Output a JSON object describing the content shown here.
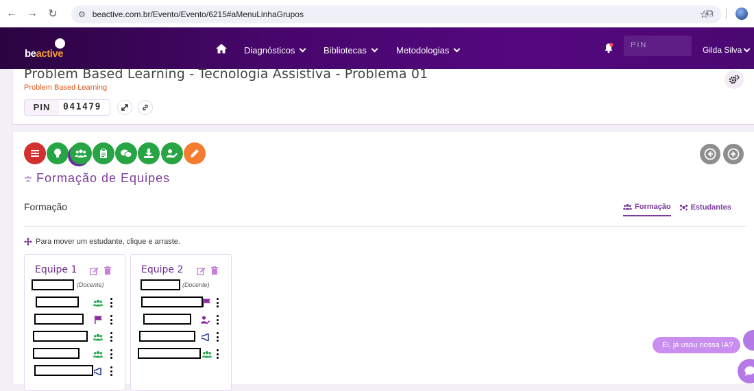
{
  "browser": {
    "url": "beactive.com.br/Evento/Evento/6215#aMenuLinhaGrupos"
  },
  "header": {
    "logo_be": "be",
    "logo_active": "active",
    "nav": [
      {
        "label": "Diagnósticos"
      },
      {
        "label": "Bibliotecas"
      },
      {
        "label": "Metodologias"
      }
    ],
    "pin_placeholder": "PIN",
    "user_name": "Gilda Silva",
    "colors": {
      "header_bg": "#46066a",
      "accent": "#f29a2e"
    }
  },
  "event": {
    "title": "Problem Based Learning - Tecnologia Assistiva - Problema 01",
    "methodology": "Problem Based Learning",
    "pin_label": "PIN",
    "pin_value": "041479"
  },
  "toolbar": {
    "buttons": [
      {
        "icon": "menu-icon",
        "color": "#d32f2f"
      },
      {
        "icon": "lightbulb-icon",
        "color": "#27a444"
      },
      {
        "icon": "users-icon",
        "color": "#27a444"
      },
      {
        "icon": "clipboard-icon",
        "color": "#27a444"
      },
      {
        "icon": "comments-icon",
        "color": "#27a444"
      },
      {
        "icon": "download-icon",
        "color": "#27a444"
      },
      {
        "icon": "user-edit-icon",
        "color": "#27a444"
      },
      {
        "icon": "pencil-icon",
        "color": "#f47c30"
      }
    ]
  },
  "section": {
    "title": "Formação de Equipes",
    "label": "Formação",
    "tabs": [
      {
        "label": "Formação",
        "active": true
      },
      {
        "label": "Estudantes",
        "active": false
      }
    ],
    "hint": "Para mover um estudante, clique e arraste."
  },
  "teams": [
    {
      "name": "Equipe 1",
      "docente": "(Docente)",
      "members": [
        {
          "role_icon": "users-icon"
        },
        {
          "role_icon": "flag-icon"
        },
        {
          "role_icon": "users-icon"
        },
        {
          "role_icon": "users-icon"
        },
        {
          "role_icon": "megaphone-icon"
        }
      ]
    },
    {
      "name": "Equipe 2",
      "docente": "(Docente)",
      "members": [
        {
          "role_icon": "flag-icon"
        },
        {
          "role_icon": "user-edit-icon"
        },
        {
          "role_icon": "megaphone-icon"
        },
        {
          "role_icon": "users-icon"
        }
      ]
    }
  ],
  "chat": {
    "bubble_text": "Ei, já usou nossa IA?"
  }
}
